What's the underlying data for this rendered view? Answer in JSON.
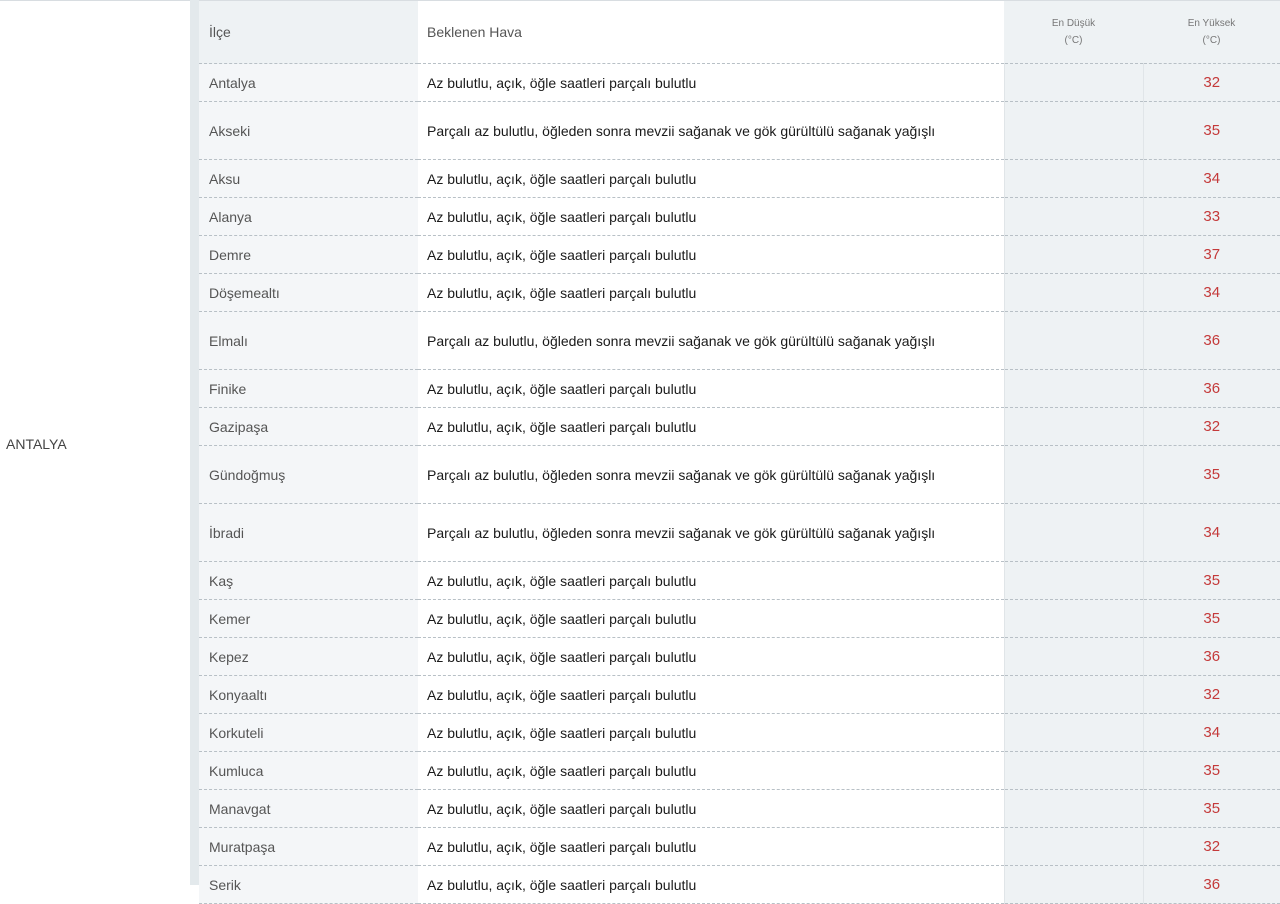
{
  "province": "ANTALYA",
  "headers": {
    "district": "İlçe",
    "forecast": "Beklenen Hava",
    "min_line1": "En Düşük",
    "min_line2": "(°C)",
    "max_line1": "En Yüksek",
    "max_line2": "(°C)"
  },
  "rows": [
    {
      "district": "Antalya",
      "forecast": "Az bulutlu, açık, öğle saatleri parçalı bulutlu",
      "max": "32"
    },
    {
      "district": "Akseki",
      "forecast": "Parçalı az bulutlu, öğleden sonra mevzii sağanak ve gök gürültülü sağanak yağışlı",
      "max": "35"
    },
    {
      "district": "Aksu",
      "forecast": "Az bulutlu, açık, öğle saatleri parçalı bulutlu",
      "max": "34"
    },
    {
      "district": "Alanya",
      "forecast": "Az bulutlu, açık, öğle saatleri parçalı bulutlu",
      "max": "33"
    },
    {
      "district": "Demre",
      "forecast": "Az bulutlu, açık, öğle saatleri parçalı bulutlu",
      "max": "37"
    },
    {
      "district": "Döşemealtı",
      "forecast": "Az bulutlu, açık, öğle saatleri parçalı bulutlu",
      "max": "34"
    },
    {
      "district": "Elmalı",
      "forecast": "Parçalı az bulutlu, öğleden sonra mevzii sağanak ve gök gürültülü sağanak yağışlı",
      "max": "36"
    },
    {
      "district": "Finike",
      "forecast": "Az bulutlu, açık, öğle saatleri parçalı bulutlu",
      "max": "36"
    },
    {
      "district": "Gazipaşa",
      "forecast": "Az bulutlu, açık, öğle saatleri parçalı bulutlu",
      "max": "32"
    },
    {
      "district": "Gündoğmuş",
      "forecast": "Parçalı az bulutlu, öğleden sonra mevzii sağanak ve gök gürültülü sağanak yağışlı",
      "max": "35"
    },
    {
      "district": "İbradi",
      "forecast": "Parçalı az bulutlu, öğleden sonra mevzii sağanak ve gök gürültülü sağanak yağışlı",
      "max": "34"
    },
    {
      "district": "Kaş",
      "forecast": "Az bulutlu, açık, öğle saatleri parçalı bulutlu",
      "max": "35"
    },
    {
      "district": "Kemer",
      "forecast": "Az bulutlu, açık, öğle saatleri parçalı bulutlu",
      "max": "35"
    },
    {
      "district": "Kepez",
      "forecast": "Az bulutlu, açık, öğle saatleri parçalı bulutlu",
      "max": "36"
    },
    {
      "district": "Konyaaltı",
      "forecast": "Az bulutlu, açık, öğle saatleri parçalı bulutlu",
      "max": "32"
    },
    {
      "district": "Korkuteli",
      "forecast": "Az bulutlu, açık, öğle saatleri parçalı bulutlu",
      "max": "34"
    },
    {
      "district": "Kumluca",
      "forecast": "Az bulutlu, açık, öğle saatleri parçalı bulutlu",
      "max": "35"
    },
    {
      "district": "Manavgat",
      "forecast": "Az bulutlu, açık, öğle saatleri parçalı bulutlu",
      "max": "35"
    },
    {
      "district": "Muratpaşa",
      "forecast": "Az bulutlu, açık, öğle saatleri parçalı bulutlu",
      "max": "32"
    },
    {
      "district": "Serik",
      "forecast": "Az bulutlu, açık, öğle saatleri parçalı bulutlu",
      "max": "36"
    }
  ]
}
